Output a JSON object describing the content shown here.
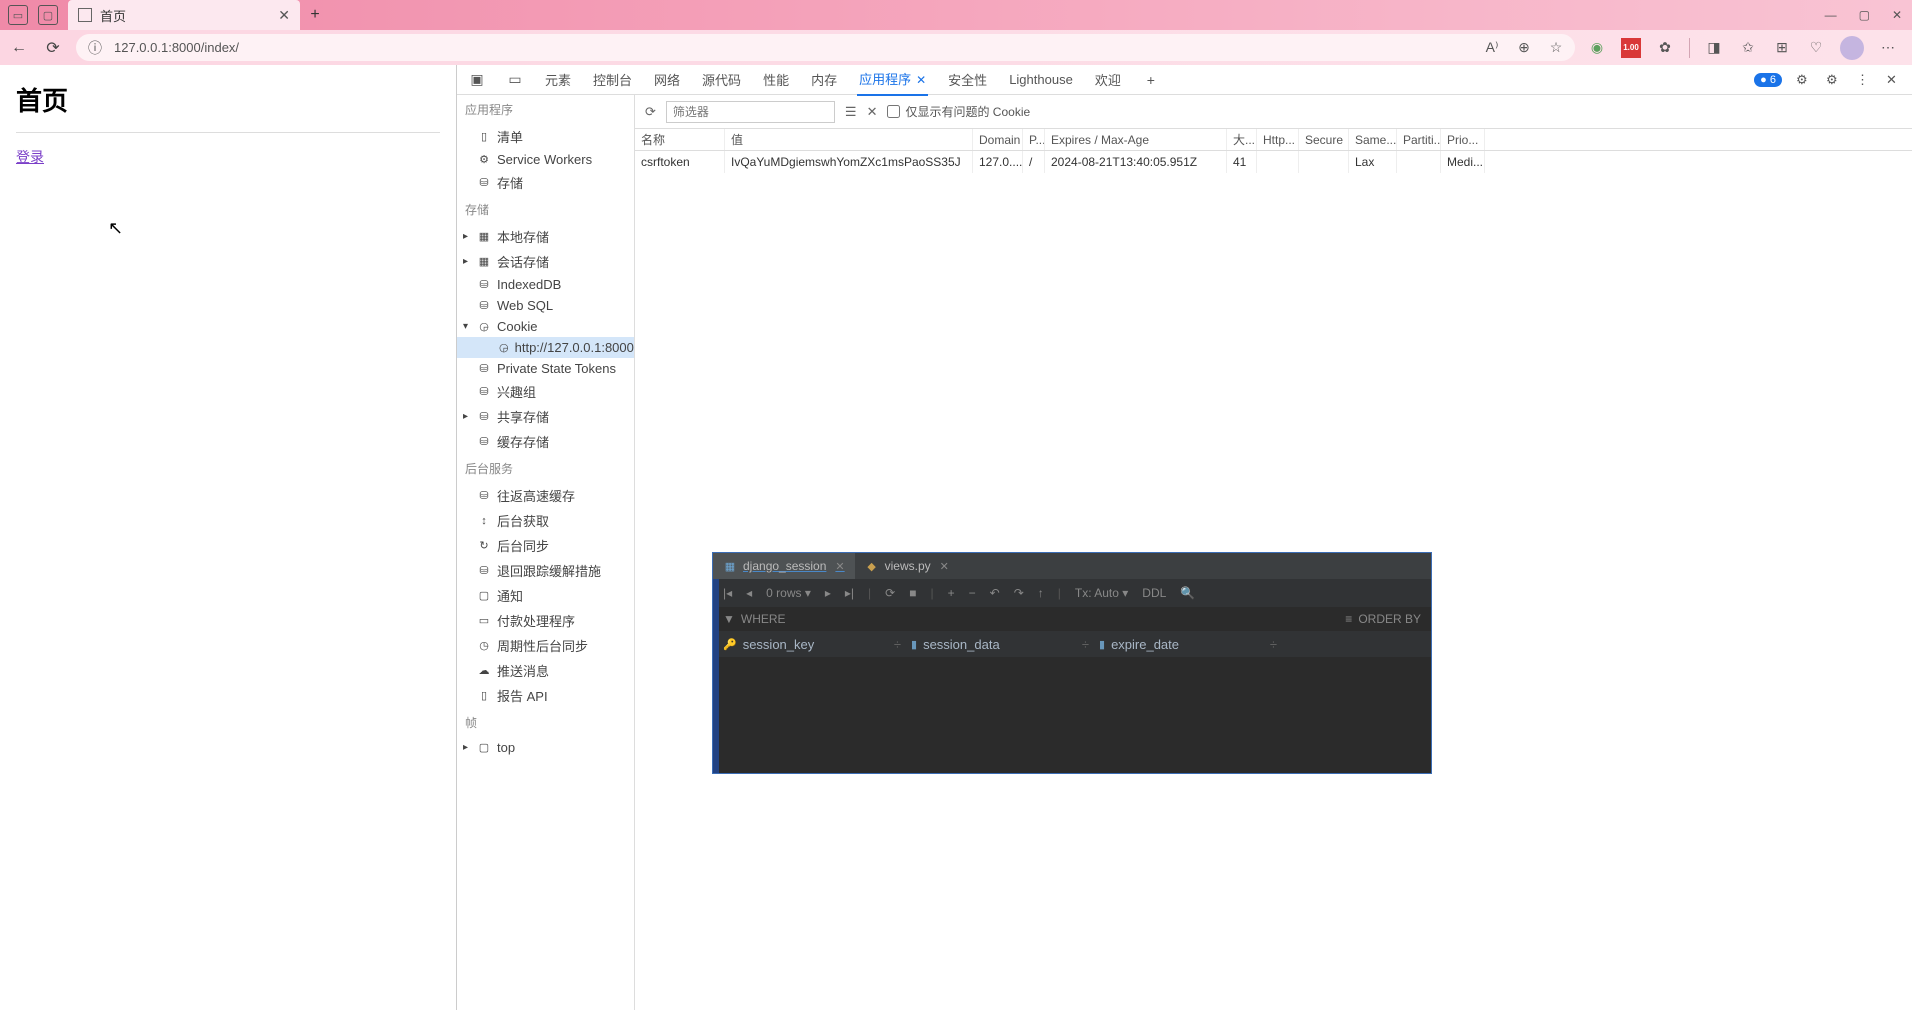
{
  "browser": {
    "tab_title": "首页",
    "url": "127.0.0.1:8000/index/",
    "ext_badge": "1.00",
    "win": {
      "min": "—",
      "max": "▢",
      "close": "✕"
    }
  },
  "page": {
    "heading": "首页",
    "login_link": "登录"
  },
  "devtools": {
    "tabs": {
      "elements": "元素",
      "console": "控制台",
      "network": "网络",
      "sources": "源代码",
      "performance": "性能",
      "memory": "内存",
      "application": "应用程序",
      "security": "安全性",
      "lighthouse": "Lighthouse",
      "welcome": "欢迎"
    },
    "issues_count": "6",
    "sidebar": {
      "sect_app": "应用程序",
      "manifest": "清单",
      "sw": "Service Workers",
      "storage": "存储",
      "sect_storage": "存储",
      "local": "本地存储",
      "session": "会话存储",
      "indexed": "IndexedDB",
      "websql": "Web SQL",
      "cookie": "Cookie",
      "cookie_host": "http://127.0.0.1:8000",
      "pst": "Private State Tokens",
      "interest": "兴趣组",
      "shared": "共享存储",
      "cache_store": "缓存存储",
      "sect_bg": "后台服务",
      "bfcache": "往返高速缓存",
      "bgfetch": "后台获取",
      "bgsync": "后台同步",
      "bounce": "退回跟踪缓解措施",
      "notif": "通知",
      "payment": "付款处理程序",
      "periodic": "周期性后台同步",
      "push": "推送消息",
      "report": "报告 API",
      "sect_frames": "帧",
      "top": "top"
    },
    "cookiebar": {
      "filter_ph": "筛选器",
      "only_issues": "仅显示有问题的 Cookie"
    },
    "cookie_headers": {
      "name": "名称",
      "value": "值",
      "domain": "Domain",
      "path": "P...",
      "expires": "Expires / Max-Age",
      "size": "大...",
      "http": "Http...",
      "secure": "Secure",
      "same": "Same...",
      "part": "Partiti...",
      "prio": "Prio..."
    },
    "cookies": [
      {
        "name": "csrftoken",
        "value": "IvQaYuMDgiemswhYomZXc1msPaoSS35J",
        "domain": "127.0....",
        "path": "/",
        "expires": "2024-08-21T13:40:05.951Z",
        "size": "41",
        "http": "",
        "secure": "",
        "same": "Lax",
        "part": "",
        "prio": "Medi..."
      }
    ]
  },
  "ide": {
    "tabs": {
      "t1": "django_session",
      "t2": "views.py"
    },
    "tool": {
      "rows": "0 rows",
      "tx": "Tx: Auto",
      "ddl": "DDL"
    },
    "filter": {
      "where": "WHERE",
      "order": "ORDER BY"
    },
    "cols": {
      "c1": "session_key",
      "c2": "session_data",
      "c3": "expire_date"
    }
  }
}
